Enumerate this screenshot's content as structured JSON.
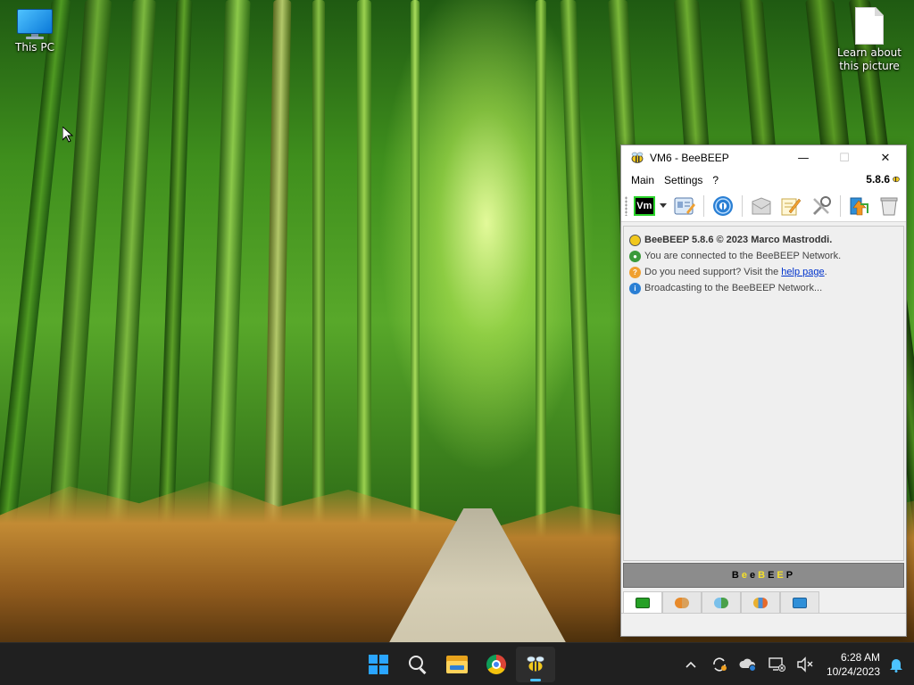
{
  "desktop": {
    "icons": [
      {
        "label": "This PC",
        "icon": "monitor-icon"
      },
      {
        "label": "Learn about this picture",
        "icon": "document-icon"
      }
    ]
  },
  "window": {
    "title": "VM6 - BeeBEEP",
    "controls": {
      "minimize": "—",
      "maximize": "☐",
      "close": "✕"
    },
    "menu": {
      "main": "Main",
      "settings": "Settings",
      "help": "?"
    },
    "version": "5.8.6",
    "toolbar": {
      "vm_label": "Vm",
      "buttons": [
        "status-selector-icon",
        "vcard-icon",
        "network-broadcast-icon",
        "message-icon",
        "edit-icon",
        "tools-icon",
        "share-icon",
        "clear-icon"
      ]
    },
    "messages": [
      {
        "text": "BeeBEEP 5.8.6 © 2023 Marco Mastroddi.",
        "bold": true,
        "icon": "bee-icon"
      },
      {
        "text": "You are connected to the BeeBEEP Network.",
        "icon": "network-icon"
      },
      {
        "prefix": "Do you need support? Visit the ",
        "link": "help page",
        "suffix": ".",
        "icon": "support-icon"
      },
      {
        "text": "Broadcasting to the BeeBEEP Network...",
        "icon": "broadcast-icon"
      }
    ],
    "logo": {
      "letters": [
        "B",
        "e",
        "e",
        "B",
        "E",
        "E",
        "P"
      ]
    },
    "tabs": [
      "chat-tab-icon",
      "users-tab-icon",
      "groups-tab-icon",
      "meetings-tab-icon",
      "shares-tab-icon"
    ]
  },
  "taskbar": {
    "apps": [
      "start-icon",
      "search-icon",
      "file-explorer-icon",
      "chrome-icon",
      "beebeep-icon"
    ],
    "tray": {
      "time": "6:28 AM",
      "date": "10/24/2023"
    }
  },
  "colors": {
    "taskbar_bg": "#202020",
    "accent": "#4cc2ff",
    "logo_bar": "#8c8c8c",
    "logo_yellow": "#f5e02a",
    "link": "#0033cc"
  }
}
